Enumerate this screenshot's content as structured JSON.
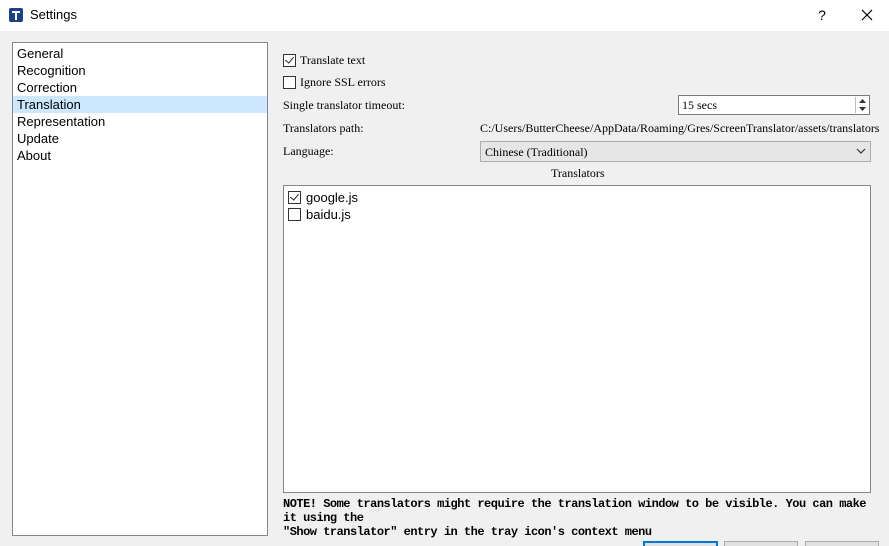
{
  "window": {
    "title": "Settings",
    "help_label": "?",
    "app_icon": "app-t-icon"
  },
  "sidebar": {
    "items": [
      {
        "label": "General"
      },
      {
        "label": "Recognition"
      },
      {
        "label": "Correction"
      },
      {
        "label": "Translation",
        "selected": true
      },
      {
        "label": "Representation"
      },
      {
        "label": "Update"
      },
      {
        "label": "About"
      }
    ]
  },
  "translation": {
    "translate_text_label": "Translate text",
    "translate_text_checked": true,
    "ignore_ssl_label": "Ignore SSL errors",
    "ignore_ssl_checked": false,
    "timeout_label": "Single translator timeout:",
    "timeout_value": "15 secs",
    "path_label": "Translators path:",
    "path_value": "C:/Users/ButterCheese/AppData/Roaming/Gres/ScreenTranslator/assets/translators",
    "language_label": "Language:",
    "language_value": "Chinese (Traditional)",
    "translators_header": "Translators",
    "translators": [
      {
        "name": "google.js",
        "checked": true
      },
      {
        "name": "baidu.js",
        "checked": false
      }
    ],
    "note_line1": "NOTE! Some translators might require the translation window to be visible. You can make it using the",
    "note_line2": "\"Show translator\" entry in the tray icon's context menu"
  },
  "colors": {
    "selection": "#cce8ff",
    "primary_button_border": "#0078d7"
  }
}
